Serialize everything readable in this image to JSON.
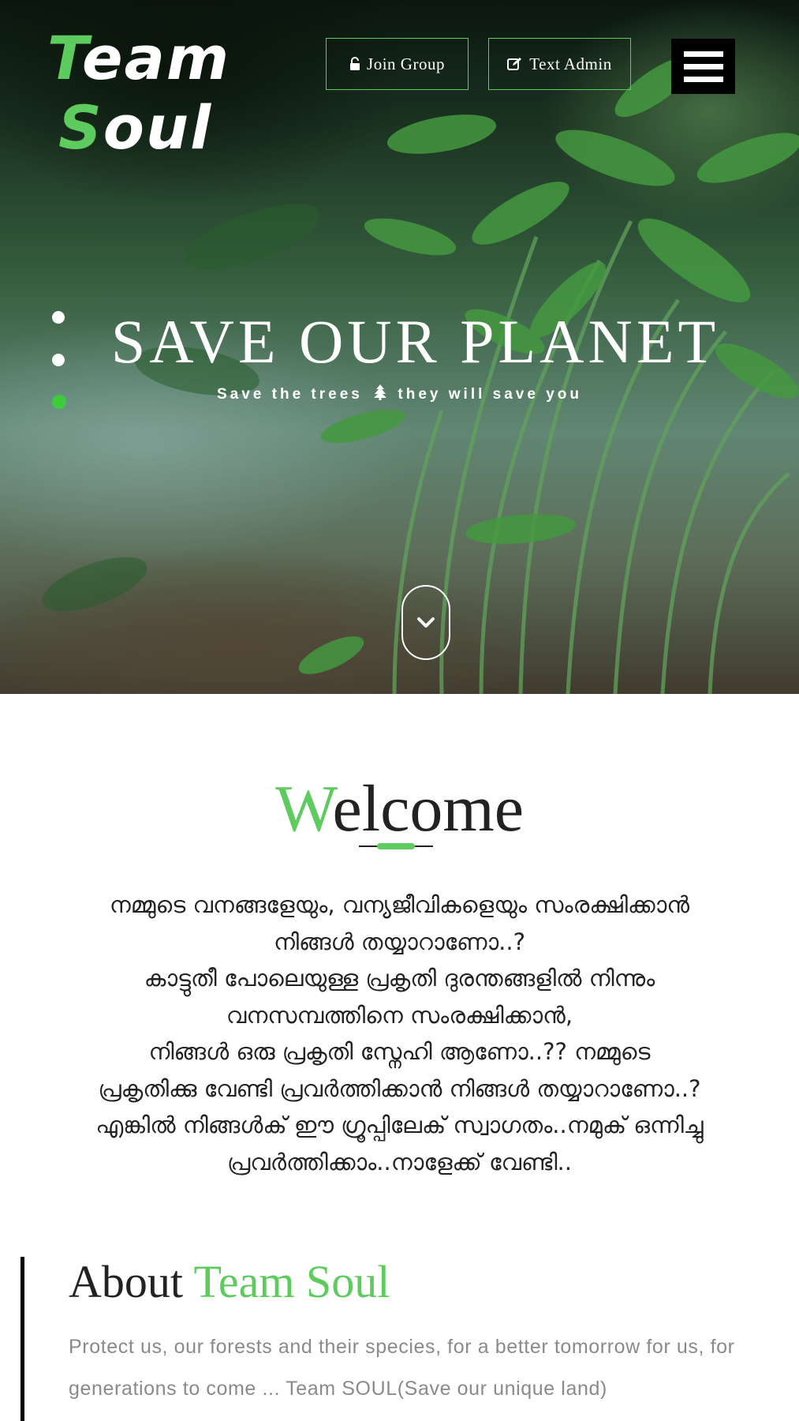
{
  "header": {
    "logo": {
      "line1_accent": "T",
      "line1_rest": "eam",
      "line2_accent": "S",
      "line2_rest": "oul"
    },
    "buttons": [
      {
        "label": "Join Group",
        "icon": "unlock-icon"
      },
      {
        "label": "Text Admin",
        "icon": "edit-icon"
      }
    ],
    "menu_icon": "hamburger-menu-icon"
  },
  "hero": {
    "title": "SAVE OUR PLANET",
    "subtitle_before": "Save the trees",
    "subtitle_icon": "tree-icon",
    "subtitle_after": "they will save you",
    "slides": {
      "count": 3,
      "active_index": 2
    },
    "scroll_icon": "chevron-down-icon"
  },
  "welcome": {
    "title_accent": "W",
    "title_rest": "elcome",
    "lines": [
      "നമ്മുടെ വനങ്ങളേയും, വന്യജീവികളെയും സംരക്ഷിക്കാൻ",
      "നിങ്ങൾ തയ്യാറാണോ..?",
      "കാട്ടുതീ പോലെയുള്ള പ്രകൃതി ദുരന്തങ്ങളിൽ നിന്നും",
      "വനസമ്പത്തിനെ സംരക്ഷിക്കാൻ,",
      "നിങ്ങൾ ഒരു പ്രകൃതി സ്നേഹി ആണോ..?? നമ്മുടെ",
      "പ്രകൃതിക്കു വേണ്ടി പ്രവർത്തിക്കാൻ നിങ്ങൾ തയ്യാറാണോ..?",
      "എങ്കിൽ നിങ്ങൾക് ഈ ഗ്രൂപ്പിലേക് സ്വാഗതം..നമുക് ഒന്നിച്ചു",
      "പ്രവർത്തിക്കാം..നാളേക്ക് വേണ്ടി.."
    ]
  },
  "about": {
    "title_plain": "About ",
    "title_accent": "Team Soul",
    "text": "Protect us, our forests and their species, for a better tomorrow for us, for generations to come ... Team SOUL(Save our unique land)"
  },
  "colors": {
    "accent": "#5ecb5e",
    "dark": "#222222",
    "muted": "#8a8a8a"
  }
}
